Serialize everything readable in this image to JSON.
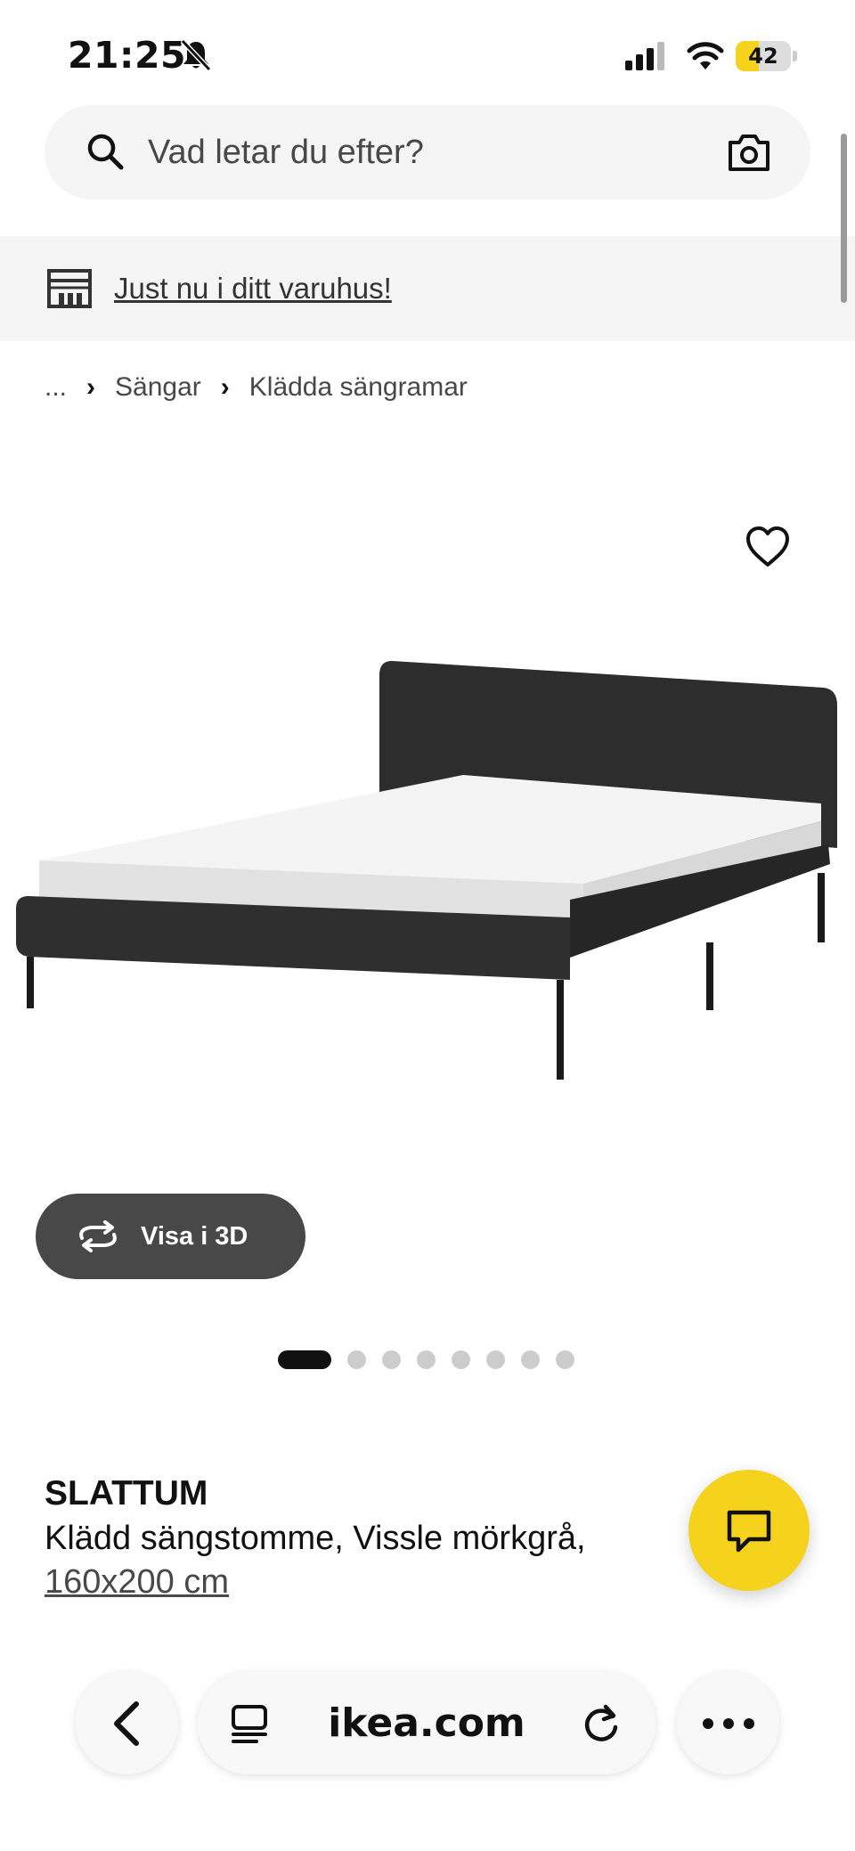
{
  "status_bar": {
    "time": "21:25",
    "battery": "42",
    "battery_level": 0.42
  },
  "search": {
    "placeholder": "Vad letar du efter?"
  },
  "store_banner": {
    "link": "Just nu i ditt varuhus!"
  },
  "breadcrumb": {
    "ellipsis": "...",
    "items": [
      "Sängar",
      "Klädda sängramar"
    ]
  },
  "product": {
    "view3d_label": "Visa i 3D",
    "image_count": 8,
    "active_image": 1,
    "brand": "SLATTUM",
    "description": "Klädd sängstomme, Vissle mörkgrå,",
    "size": "160x200 cm"
  },
  "browser": {
    "url": "ikea.com"
  },
  "colors": {
    "accent_yellow": "#f5d21c",
    "dark_button": "#484848",
    "bed_fabric": "#2d2d2d"
  }
}
